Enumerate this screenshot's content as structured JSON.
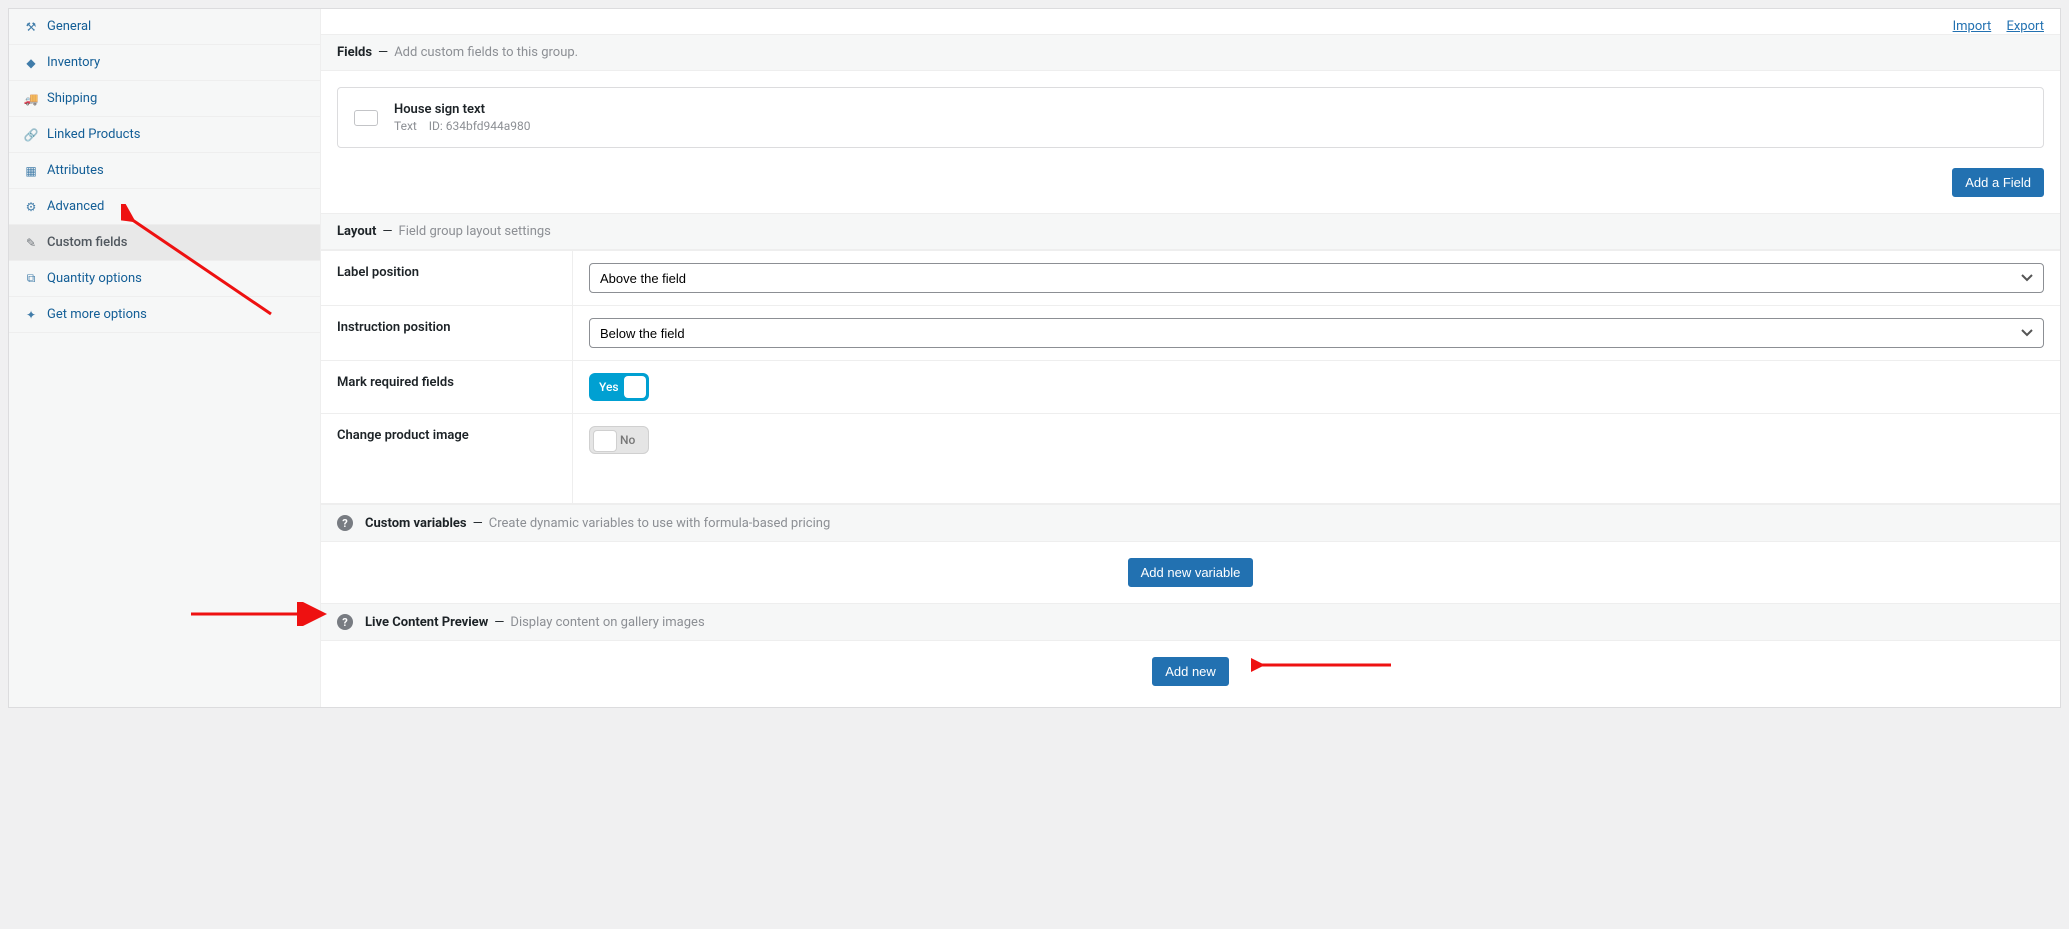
{
  "sidebar": {
    "items": [
      {
        "label": "General",
        "icon": "⚒"
      },
      {
        "label": "Inventory",
        "icon": "◆"
      },
      {
        "label": "Shipping",
        "icon": "🚚"
      },
      {
        "label": "Linked Products",
        "icon": "🔗"
      },
      {
        "label": "Attributes",
        "icon": "▦"
      },
      {
        "label": "Advanced",
        "icon": "⚙"
      },
      {
        "label": "Custom fields",
        "icon": "✎"
      },
      {
        "label": "Quantity options",
        "icon": "⧉"
      },
      {
        "label": "Get more options",
        "icon": "✦"
      }
    ]
  },
  "top_links": {
    "import": "Import",
    "export": "Export"
  },
  "fields_section": {
    "title": "Fields",
    "subtitle": "Add custom fields to this group.",
    "card": {
      "title": "House sign text",
      "type": "Text",
      "id_label": "ID:",
      "id": "634bfd944a980"
    },
    "add_button": "Add a Field"
  },
  "layout_section": {
    "title": "Layout",
    "subtitle": "Field group layout settings",
    "rows": {
      "label_position": {
        "label": "Label position",
        "value": "Above the field"
      },
      "instruction_position": {
        "label": "Instruction position",
        "value": "Below the field"
      },
      "mark_required": {
        "label": "Mark required fields",
        "value": "Yes"
      },
      "change_image": {
        "label": "Change product image",
        "value": "No"
      }
    }
  },
  "custom_vars": {
    "title": "Custom variables",
    "subtitle": "Create dynamic variables to use with formula-based pricing",
    "button": "Add new variable"
  },
  "live_preview": {
    "title": "Live Content Preview",
    "subtitle": "Display content on gallery images",
    "button": "Add new"
  }
}
